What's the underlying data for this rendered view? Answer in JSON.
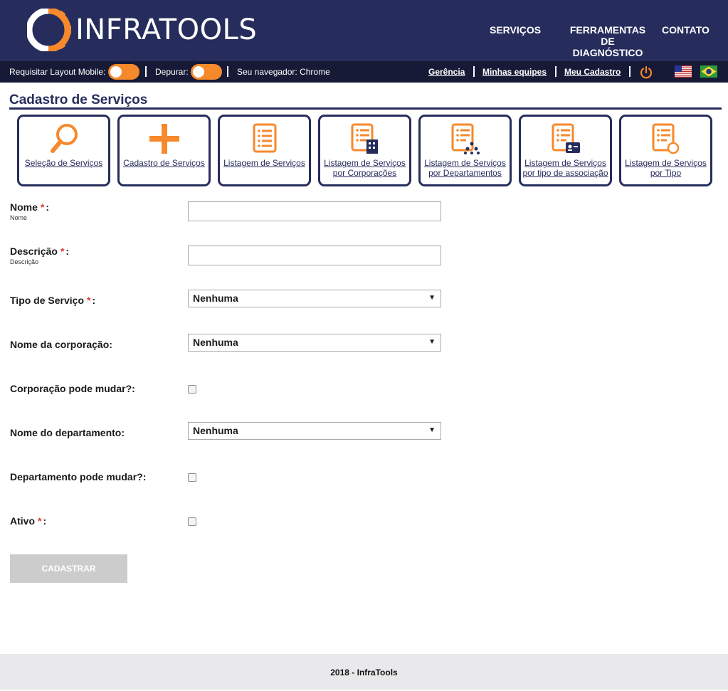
{
  "brand": {
    "name": "INFRATOOLS",
    "accent": "#f6892b",
    "primary": "#262d5c",
    "toolbar_bg": "#161a36"
  },
  "nav": {
    "servicos": "SERVIÇOS",
    "ferramentas": "FERRAMENTAS DE DIAGNÓSTICO",
    "contato": "CONTATO"
  },
  "toolbar": {
    "mobile_label": "Requisitar Layout Mobile:",
    "debug_label": "Depurar:",
    "browser_label": "Seu navegador: Chrome",
    "gerencia": "Gerência",
    "minhas_equipes": "Minhas equipes",
    "meu_cadastro": "Meu Cadastro",
    "icons": [
      "power-icon",
      "us-flag-icon",
      "brazil-flag-icon"
    ]
  },
  "page": {
    "title": "Cadastro de Serviços"
  },
  "tiles": [
    {
      "label": "Seleção de Serviços",
      "icon": "magnifier-icon"
    },
    {
      "label": "Cadastro de Serviços",
      "icon": "plus-icon"
    },
    {
      "label": "Listagem de Serviços",
      "icon": "list-icon"
    },
    {
      "label": "Listagem de Serviços por Corporações",
      "icon": "list-building-icon"
    },
    {
      "label": "Listagem de Serviços por Departamentos",
      "icon": "list-people-icon"
    },
    {
      "label": "Listagem de Serviços por tipo de associação",
      "icon": "list-badge-icon"
    },
    {
      "label": "Listagem de Serviços por Tipo",
      "icon": "list-circle-icon"
    }
  ],
  "form": {
    "nome": {
      "label": "Nome",
      "sublabel": "Nome",
      "value": ""
    },
    "descricao": {
      "label": "Descrição",
      "sublabel": "Descrição",
      "value": ""
    },
    "tipo": {
      "label": "Tipo de Serviço",
      "selected": "Nenhuma"
    },
    "corporacao": {
      "label": "Nome da corporação:",
      "selected": "Nenhuma"
    },
    "corp_mudar": {
      "label": "Corporação pode mudar?:",
      "checked": false
    },
    "departamento": {
      "label": "Nome do departamento:",
      "selected": "Nenhuma"
    },
    "dept_mudar": {
      "label": "Departamento pode mudar?:",
      "checked": false
    },
    "ativo": {
      "label": "Ativo",
      "checked": false
    },
    "required_mark": "*",
    "colon": ":",
    "submit": "CADASTRAR"
  },
  "footer": {
    "text": "2018 - InfraTools"
  }
}
